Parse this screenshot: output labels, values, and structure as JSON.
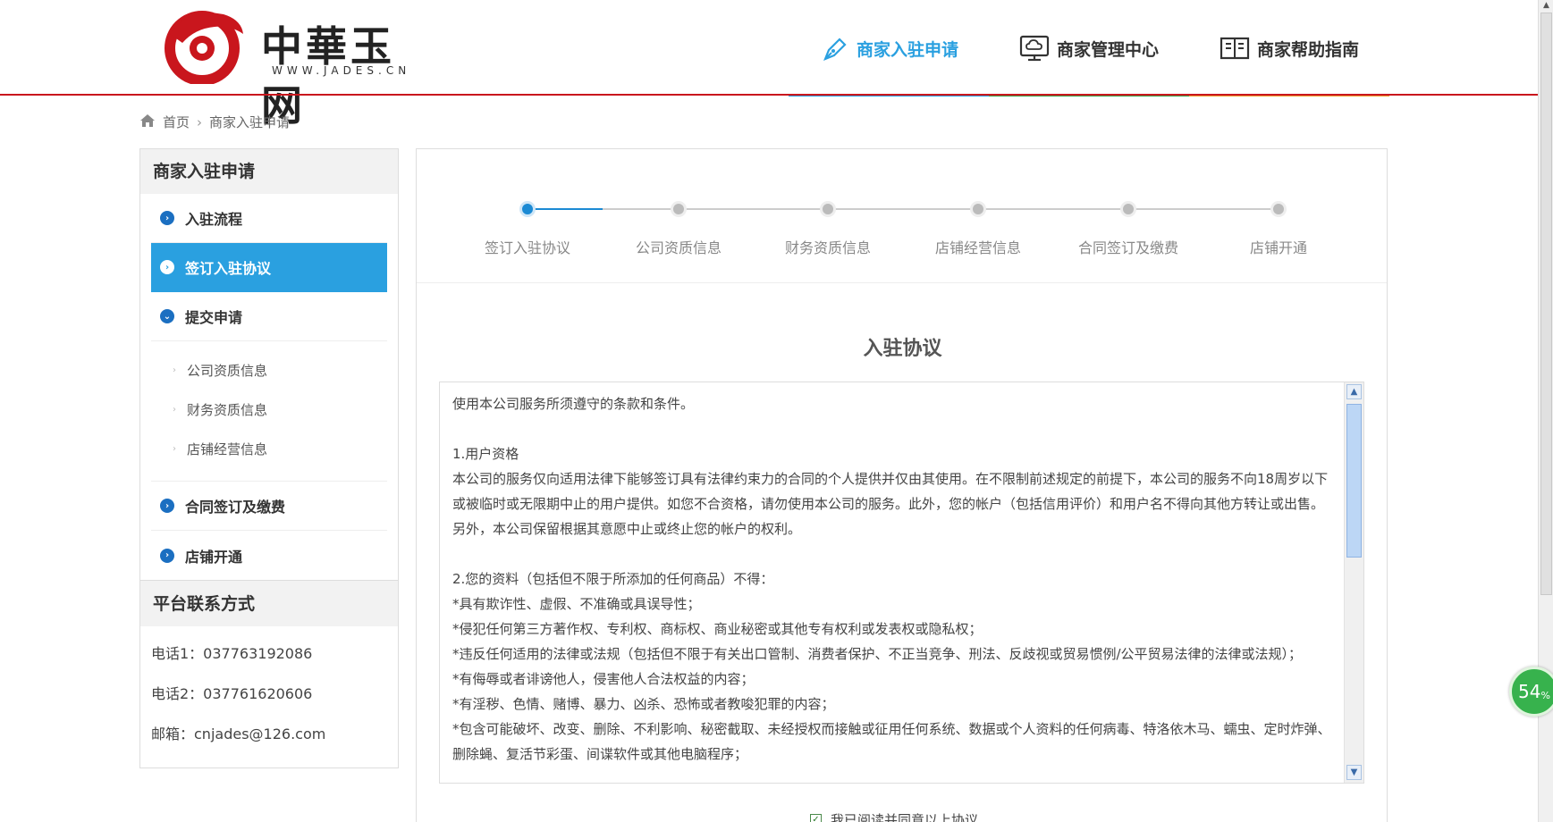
{
  "header": {
    "logo_text": "中華玉网",
    "logo_sub": "WWW.JADES.CN",
    "nav": [
      {
        "label": "商家入驻申请",
        "icon": "pen-nib-icon",
        "active": true,
        "bar_color": "#2aa0e0"
      },
      {
        "label": "商家管理中心",
        "icon": "monitor-cloud-icon",
        "active": false,
        "bar_color": "#3aa14a"
      },
      {
        "label": "商家帮助指南",
        "icon": "book-icon",
        "active": false,
        "bar_color": "#f0a030"
      }
    ]
  },
  "breadcrumb": {
    "home": "首页",
    "current": "商家入驻申请"
  },
  "sidebar": {
    "title": "商家入驻申请",
    "items": [
      {
        "label": "入驻流程",
        "active": false
      },
      {
        "label": "签订入驻协议",
        "active": true
      },
      {
        "label": "提交申请",
        "active": false
      }
    ],
    "sub_items": [
      "公司资质信息",
      "财务资质信息",
      "店铺经营信息"
    ],
    "items_after": [
      {
        "label": "合同签订及缴费"
      },
      {
        "label": "店铺开通"
      }
    ],
    "contact_title": "平台联系方式",
    "contacts": [
      "电话1：037763192086",
      "电话2：037761620606",
      "邮箱：cnjades@126.com"
    ]
  },
  "steps": [
    {
      "label": "签订入驻协议",
      "active": true
    },
    {
      "label": "公司资质信息",
      "active": false
    },
    {
      "label": "财务资质信息",
      "active": false
    },
    {
      "label": "店铺经营信息",
      "active": false
    },
    {
      "label": "合同签订及缴费",
      "active": false
    },
    {
      "label": "店铺开通",
      "active": false
    }
  ],
  "agreement": {
    "title": "入驻协议",
    "paragraphs": [
      "使用本公司服务所须遵守的条款和条件。",
      "",
      "1.用户资格",
      "本公司的服务仅向适用法律下能够签订具有法律约束力的合同的个人提供并仅由其使用。在不限制前述规定的前提下，本公司的服务不向18周岁以下或被临时或无限期中止的用户提供。如您不合资格，请勿使用本公司的服务。此外，您的帐户（包括信用评价）和用户名不得向其他方转让或出售。另外，本公司保留根据其意愿中止或终止您的帐户的权利。",
      "",
      "2.您的资料（包括但不限于所添加的任何商品）不得：",
      "*具有欺诈性、虚假、不准确或具误导性；",
      "*侵犯任何第三方著作权、专利权、商标权、商业秘密或其他专有权利或发表权或隐私权；",
      "*违反任何适用的法律或法规（包括但不限于有关出口管制、消费者保护、不正当竞争、刑法、反歧视或贸易惯例/公平贸易法律的法律或法规）；",
      "*有侮辱或者诽谤他人，侵害他人合法权益的内容；",
      "*有淫秽、色情、赌博、暴力、凶杀、恐怖或者教唆犯罪的内容；",
      "*包含可能破坏、改变、删除、不利影响、秘密截取、未经授权而接触或征用任何系统、数据或个人资料的任何病毒、特洛依木马、蠕虫、定时炸弹、删除蝇、复活节彩蛋、间谍软件或其他电脑程序；"
    ],
    "agree_label": "我已阅读并同意以上协议",
    "agree_checked": true
  },
  "progress_widget": {
    "value": "54",
    "unit": "%"
  }
}
